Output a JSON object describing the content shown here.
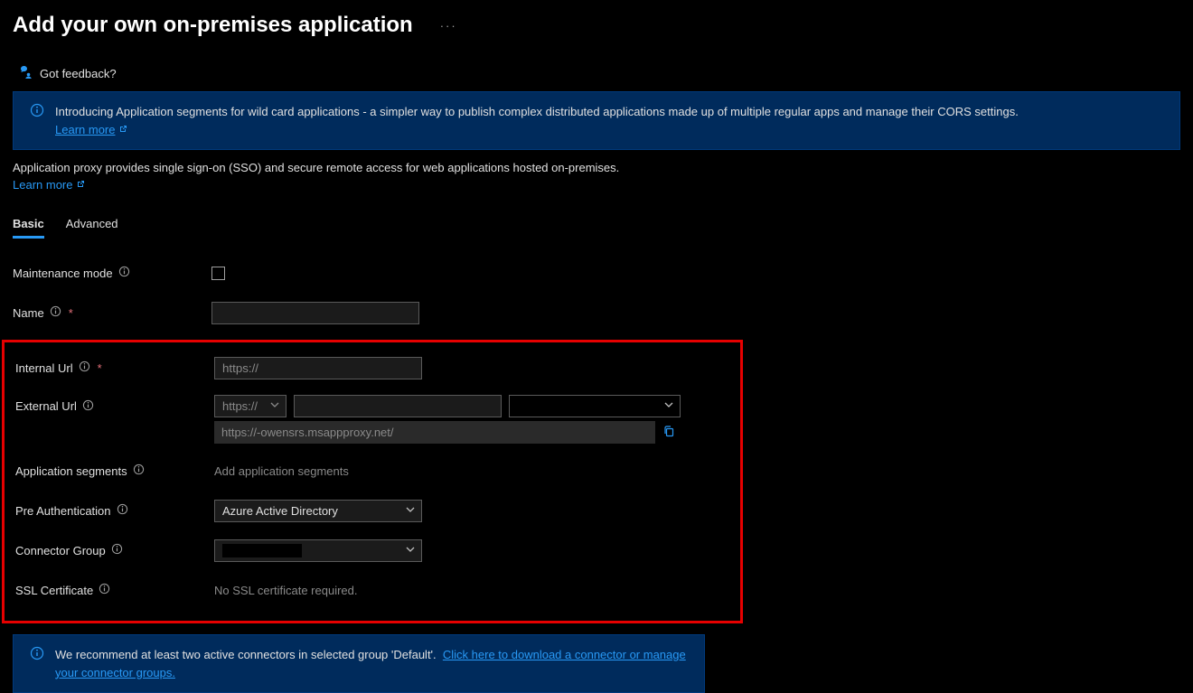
{
  "header": {
    "page_title": "Add your own on-premises application",
    "ellipsis": "···",
    "feedback_label": "Got feedback?"
  },
  "banner1": {
    "text": "Introducing Application segments for wild card applications - a simpler way to publish complex distributed applications made up of multiple regular apps and manage their CORS settings.",
    "link": "Learn more"
  },
  "description": {
    "text": "Application proxy provides single sign-on (SSO) and secure remote access for web applications hosted on-premises.",
    "link": "Learn more"
  },
  "tabs": {
    "basic": "Basic",
    "advanced": "Advanced"
  },
  "form": {
    "maintenance_label": "Maintenance mode",
    "name_label": "Name",
    "internal_url_label": "Internal Url",
    "internal_url_placeholder": "https://",
    "external_url_label": "External Url",
    "external_scheme": "https://",
    "external_full": "https://-owensrs.msappproxy.net/",
    "segments_label": "Application segments",
    "segments_add": "Add application segments",
    "preauth_label": "Pre Authentication",
    "preauth_value": "Azure Active Directory",
    "connector_label": "Connector Group",
    "ssl_label": "SSL Certificate",
    "ssl_value": "No SSL certificate required."
  },
  "banner2": {
    "text": "We recommend at least two active connectors in selected group 'Default'.",
    "link": "Click here to download a connector or manage your connector groups."
  }
}
